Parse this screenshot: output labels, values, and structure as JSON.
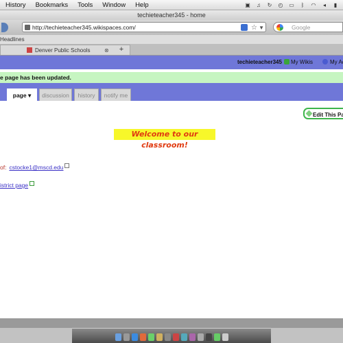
{
  "menubar": {
    "items": [
      "History",
      "Bookmarks",
      "Tools",
      "Window",
      "Help"
    ]
  },
  "window": {
    "title": "techieteacher345 - home"
  },
  "browser": {
    "url": "http://techieteacher345.wikispaces.com/",
    "search_placeholder": "Google",
    "bookmarks_bar": "Headlines",
    "tab_label": "Denver Public Schools",
    "new_tab": "+"
  },
  "wiki": {
    "username": "techieteacher345",
    "my_wikis": "My Wikis",
    "my_account": "My Ac",
    "notice": "e page has been updated.",
    "tabs": [
      {
        "label": "page ▾"
      },
      {
        "label": "discussion"
      },
      {
        "label": "history"
      },
      {
        "label": "notify me"
      }
    ],
    "edit_button": "Edit This Pa",
    "welcome": "Welcome to our classroom!",
    "contact_prefix": "of:",
    "contact_email": "cstocke1@mscd.edu",
    "district_link": "istrict page"
  },
  "colors": {
    "header_bg": "#6f77d8",
    "notice_bg": "#c6f5c1",
    "welcome_bg": "#f7f72a",
    "welcome_text": "#e03a10",
    "edit_border": "#3db54a"
  }
}
